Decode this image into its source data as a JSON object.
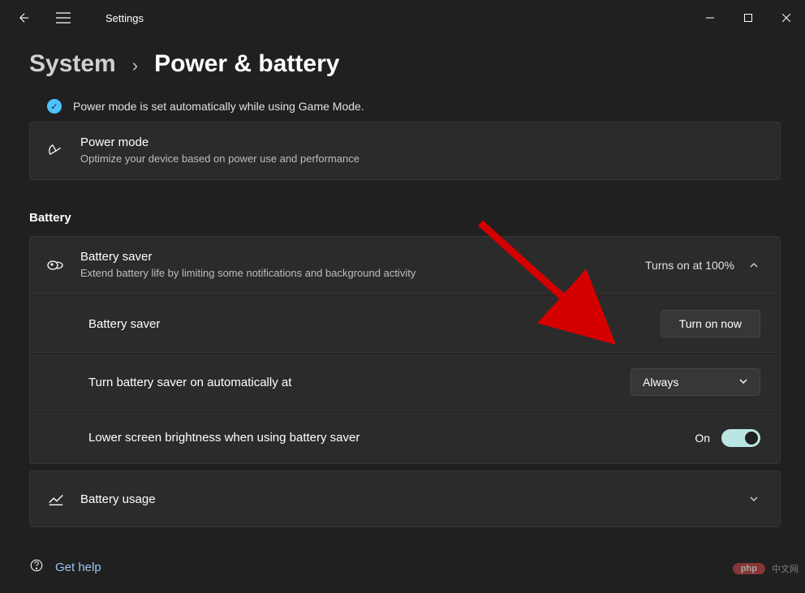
{
  "app": {
    "title": "Settings"
  },
  "breadcrumb": {
    "parent": "System",
    "current": "Power & battery"
  },
  "notice": {
    "text": "Power mode is set automatically while using Game Mode."
  },
  "power_mode": {
    "title": "Power mode",
    "subtitle": "Optimize your device based on power use and performance"
  },
  "sections": {
    "battery_heading": "Battery"
  },
  "battery_saver": {
    "header_title": "Battery saver",
    "header_subtitle": "Extend battery life by limiting some notifications and background activity",
    "header_status": "Turns on at 100%",
    "row1_label": "Battery saver",
    "row1_button": "Turn on now",
    "row2_label": "Turn battery saver on automatically at",
    "row2_value": "Always",
    "row3_label": "Lower screen brightness when using battery saver",
    "row3_state": "On"
  },
  "battery_usage": {
    "title": "Battery usage"
  },
  "footer": {
    "get_help": "Get help"
  },
  "watermark": {
    "logo": "php",
    "text": "中文网"
  }
}
